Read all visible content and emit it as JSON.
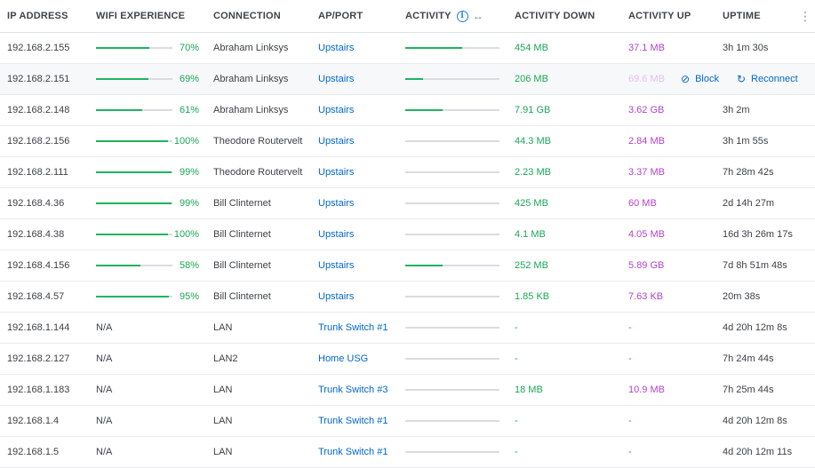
{
  "columns": {
    "ip": "IP ADDRESS",
    "wifi": "WIFI EXPERIENCE",
    "connection": "CONNECTION",
    "ap_port": "AP/PORT",
    "activity": "ACTIVITY",
    "activity_down": "ACTIVITY DOWN",
    "activity_up": "ACTIVITY UP",
    "uptime": "UPTIME"
  },
  "icons": {
    "info": "i",
    "expand": "↔",
    "menu": "⋮",
    "block": "⊘",
    "reconnect": "↻"
  },
  "row_actions": {
    "block": "Block",
    "reconnect": "Reconnect"
  },
  "colors": {
    "accent_blue": "#0068cc",
    "green": "#1fb35f",
    "purple": "#b045c9"
  },
  "rows": [
    {
      "ip": "192.168.2.155",
      "wifi_pct": "70%",
      "wifi_value": 0.7,
      "connection": "Abraham Linksys",
      "ap": "Upstairs",
      "activity": 0.6,
      "down": "454 MB",
      "up": "37.1 MB",
      "uptime": "3h 1m 30s"
    },
    {
      "ip": "192.168.2.151",
      "wifi_pct": "69%",
      "wifi_value": 0.69,
      "connection": "Abraham Linksys",
      "ap": "Upstairs",
      "activity": 0.19,
      "down": "206 MB",
      "up": "69.6 MB",
      "uptime": "",
      "hover": true
    },
    {
      "ip": "192.168.2.148",
      "wifi_pct": "61%",
      "wifi_value": 0.61,
      "connection": "Abraham Linksys",
      "ap": "Upstairs",
      "activity": 0.4,
      "down": "7.91 GB",
      "up": "3.62 GB",
      "uptime": "3h 2m"
    },
    {
      "ip": "192.168.2.156",
      "wifi_pct": "100%",
      "wifi_value": 0.94,
      "connection": "Theodore Routervelt",
      "ap": "Upstairs",
      "activity": 0,
      "down": "44.3 MB",
      "up": "2.84 MB",
      "uptime": "3h 1m 55s"
    },
    {
      "ip": "192.168.2.111",
      "wifi_pct": "99%",
      "wifi_value": 0.99,
      "connection": "Theodore Routervelt",
      "ap": "Upstairs",
      "activity": 0,
      "down": "2.23 MB",
      "up": "3.37 MB",
      "uptime": "7h 28m 42s"
    },
    {
      "ip": "192.168.4.36",
      "wifi_pct": "99%",
      "wifi_value": 0.99,
      "connection": "Bill Clinternet",
      "ap": "Upstairs",
      "activity": 0,
      "down": "425 MB",
      "up": "60 MB",
      "uptime": "2d 14h 27m"
    },
    {
      "ip": "192.168.4.38",
      "wifi_pct": "100%",
      "wifi_value": 0.94,
      "connection": "Bill Clinternet",
      "ap": "Upstairs",
      "activity": 0,
      "down": "4.1 MB",
      "up": "4.05 MB",
      "uptime": "16d 3h 26m 17s"
    },
    {
      "ip": "192.168.4.156",
      "wifi_pct": "58%",
      "wifi_value": 0.58,
      "connection": "Bill Clinternet",
      "ap": "Upstairs",
      "activity": 0.4,
      "down": "252 MB",
      "up": "5.89 GB",
      "uptime": "7d 8h 51m 48s"
    },
    {
      "ip": "192.168.4.57",
      "wifi_pct": "95%",
      "wifi_value": 0.95,
      "connection": "Bill Clinternet",
      "ap": "Upstairs",
      "activity": 0,
      "down": "1.85 KB",
      "up": "7.63 KB",
      "uptime": "20m 38s"
    },
    {
      "ip": "192.168.1.144",
      "wifi_na": "N/A",
      "connection": "LAN",
      "ap": "Trunk Switch #1",
      "activity": 0,
      "down": "-",
      "up": "-",
      "uptime": "4d 20h 12m 8s"
    },
    {
      "ip": "192.168.2.127",
      "wifi_na": "N/A",
      "connection": "LAN2",
      "ap": "Home USG",
      "activity": 0,
      "down": "-",
      "up": "-",
      "uptime": "7h 24m 44s"
    },
    {
      "ip": "192.168.1.183",
      "wifi_na": "N/A",
      "connection": "LAN",
      "ap": "Trunk Switch #3",
      "activity": 0,
      "down": "18 MB",
      "up": "10.9 MB",
      "uptime": "7h 25m 44s"
    },
    {
      "ip": "192.168.1.4",
      "wifi_na": "N/A",
      "connection": "LAN",
      "ap": "Trunk Switch #1",
      "activity": 0,
      "down": "-",
      "up": "-",
      "uptime": "4d 20h 12m 8s"
    },
    {
      "ip": "192.168.1.5",
      "wifi_na": "N/A",
      "connection": "LAN",
      "ap": "Trunk Switch #1",
      "activity": 0,
      "down": "-",
      "up": "-",
      "uptime": "4d 20h 12m 11s"
    }
  ]
}
